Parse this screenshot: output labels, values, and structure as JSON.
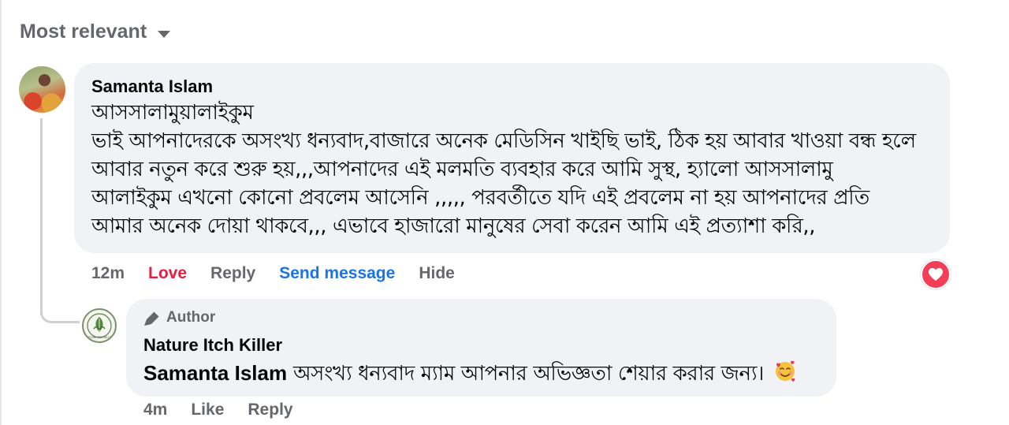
{
  "sort": {
    "label": "Most relevant",
    "icon": "caret-down-icon"
  },
  "comment": {
    "author": "Samanta Islam",
    "lines": [
      "আসসালামুয়ালাইকুম",
      "ভাই আপনাদেরকে অসংখ্য ধন্যবাদ,বাজারে অনেক মেডিসিন খাইছি ভাই, ঠিক হয় আবার খাওয়া বন্ধ হলে",
      "আবার নতুন করে শুরু হয়,,,আপনাদের এই মলমতি ব্যবহার করে আমি সুস্থ, হ্যালো আসসালামু",
      "আলাইকুম এখনো কোনো প্রবলেম আসেনি ,,,,, পরবর্তীতে যদি এই প্রবলেম না হয় আপনাদের প্রতি",
      "আমার অনেক দোয়া থাকবে,,, এভাবে হাজারো মানুষের সেবা করেন আমি এই প্রত্যাশা করি,,"
    ],
    "time": "12m",
    "love_label": "Love",
    "reply_label": "Reply",
    "send_message_label": "Send message",
    "hide_label": "Hide",
    "reaction_icon": "heart-icon"
  },
  "reply": {
    "badge_label": "Author",
    "badge_icon": "pencil-icon",
    "author": "Nature Itch Killer",
    "mention": "Samanta Islam",
    "text": "অসংখ্য ধন্যবাদ ম্যাম আপনার অভিজ্ঞতা শেয়ার করার জন্য।",
    "emoji": "smiling-face-with-hearts-icon",
    "avatar_text": "NATURE ITCH KILLER",
    "time": "4m",
    "like_label": "Like",
    "reply_label": "Reply"
  },
  "colors": {
    "love": "#e41e3f",
    "link_blue": "#1b74e4",
    "muted": "#65676b",
    "bubble": "#f0f2f5",
    "reaction": "#f33e58"
  }
}
